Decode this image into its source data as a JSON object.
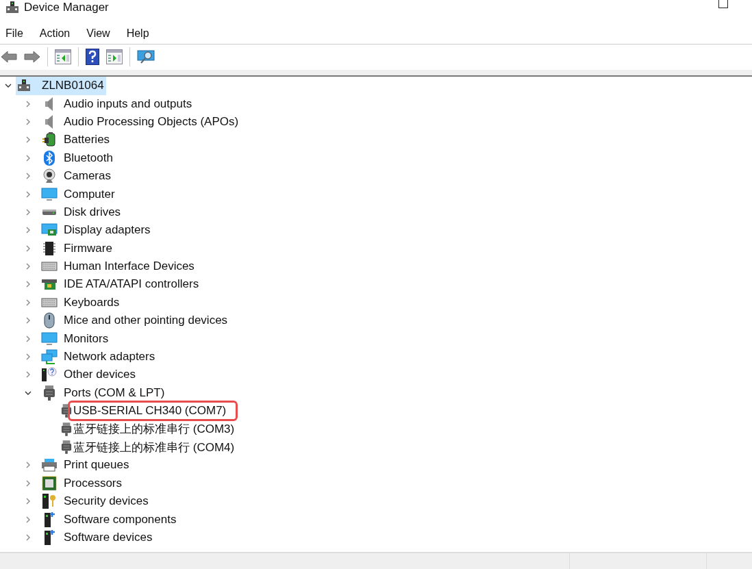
{
  "window": {
    "title": "Device Manager"
  },
  "menu": [
    "File",
    "Action",
    "View",
    "Help"
  ],
  "toolbar": [
    {
      "kind": "back",
      "disabled": true
    },
    {
      "kind": "forward",
      "disabled": true
    },
    {
      "kind": "separator"
    },
    {
      "kind": "console-tree",
      "disabled": false
    },
    {
      "kind": "separator"
    },
    {
      "kind": "help",
      "disabled": false
    },
    {
      "kind": "action-pane",
      "disabled": false
    },
    {
      "kind": "separator"
    },
    {
      "kind": "scan",
      "disabled": false
    }
  ],
  "tree": {
    "label": "ZLNB01064",
    "selected": true,
    "expanded": true,
    "children": [
      {
        "label": "Audio inputs and outputs",
        "selected": false,
        "expanded": false
      },
      {
        "label": "Audio Processing Objects (APOs)",
        "selected": false,
        "expanded": false
      },
      {
        "label": "Batteries",
        "selected": false,
        "expanded": false
      },
      {
        "label": "Bluetooth",
        "selected": false,
        "expanded": false
      },
      {
        "label": "Cameras",
        "selected": false,
        "expanded": false
      },
      {
        "label": "Computer",
        "selected": false,
        "expanded": false
      },
      {
        "label": "Disk drives",
        "selected": false,
        "expanded": false
      },
      {
        "label": "Display adapters",
        "selected": false,
        "expanded": false
      },
      {
        "label": "Firmware",
        "selected": false,
        "expanded": false
      },
      {
        "label": "Human Interface Devices",
        "selected": false,
        "expanded": false
      },
      {
        "label": "IDE ATA/ATAPI controllers",
        "selected": false,
        "expanded": false
      },
      {
        "label": "Keyboards",
        "selected": false,
        "expanded": false
      },
      {
        "label": "Mice and other pointing devices",
        "selected": false,
        "expanded": false
      },
      {
        "label": "Monitors",
        "selected": false,
        "expanded": false
      },
      {
        "label": "Network adapters",
        "selected": false,
        "expanded": false
      },
      {
        "label": "Other devices",
        "selected": false,
        "expanded": false
      },
      {
        "label": "Ports (COM & LPT)",
        "selected": false,
        "expanded": true,
        "children": [
          {
            "label": "USB-SERIAL CH340 (COM7)",
            "selected": false,
            "highlighted": true
          },
          {
            "label": "蓝牙链接上的标准串行 (COM3)",
            "selected": false,
            "highlighted": false
          },
          {
            "label": "蓝牙链接上的标准串行 (COM4)",
            "selected": false,
            "highlighted": false
          }
        ]
      },
      {
        "label": "Print queues",
        "selected": false,
        "expanded": false
      },
      {
        "label": "Processors",
        "selected": false,
        "expanded": false
      },
      {
        "label": "Security devices",
        "selected": false,
        "expanded": false
      },
      {
        "label": "Software components",
        "selected": false,
        "expanded": false
      },
      {
        "label": "Software devices",
        "selected": false,
        "expanded": false
      }
    ]
  }
}
